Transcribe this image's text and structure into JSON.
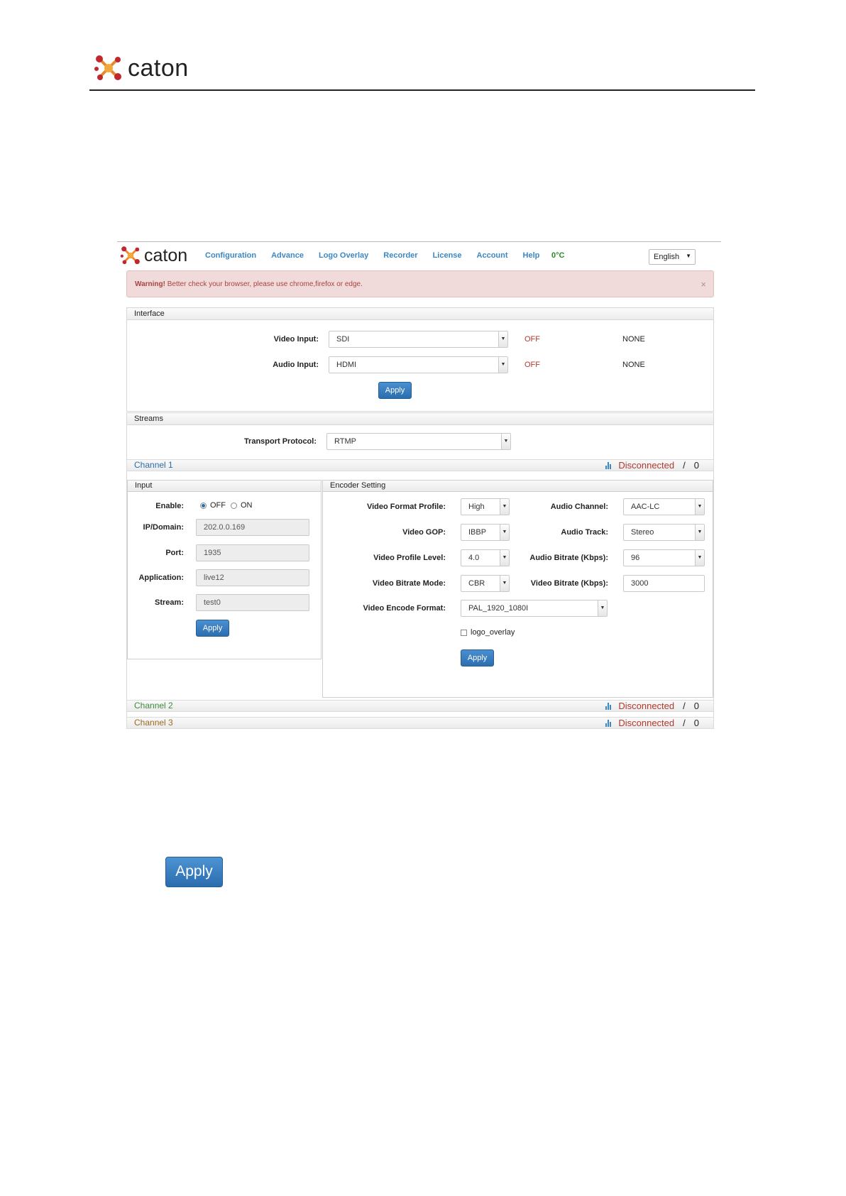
{
  "document": {
    "brand": "caton"
  },
  "nav": {
    "brand": "caton",
    "menu": [
      "Configuration",
      "Advance",
      "Logo Overlay",
      "Recorder",
      "License",
      "Account",
      "Help"
    ],
    "temperature": "0°C",
    "language": "English"
  },
  "warning": {
    "strong": "Warning!",
    "text": " Better check your browser, please use chrome,firefox or edge.",
    "close": "×"
  },
  "interface": {
    "title": "Interface",
    "video_input_label": "Video Input:",
    "video_input_value": "SDI",
    "video_status": "OFF",
    "video_signal": "NONE",
    "audio_input_label": "Audio Input:",
    "audio_input_value": "HDMI",
    "audio_status": "OFF",
    "audio_signal": "NONE",
    "apply": "Apply"
  },
  "streams": {
    "title": "Streams",
    "protocol_label": "Transport Protocol:",
    "protocol_value": "RTMP"
  },
  "channels": [
    {
      "name": "Channel 1",
      "color": "#2a6ea6",
      "status": "Disconnected",
      "sep": "/",
      "count": "0"
    },
    {
      "name": "Channel 2",
      "color": "#3f8a3f",
      "status": "Disconnected",
      "sep": "/",
      "count": "0"
    },
    {
      "name": "Channel 3",
      "color": "#9a6a1e",
      "status": "Disconnected",
      "sep": "/",
      "count": "0"
    }
  ],
  "input": {
    "title": "Input",
    "enable_label": "Enable:",
    "off": "OFF",
    "on": "ON",
    "ip_label": "IP/Domain:",
    "ip_value": "202.0.0.169",
    "port_label": "Port:",
    "port_value": "1935",
    "app_label": "Application:",
    "app_value": "live12",
    "stream_label": "Stream:",
    "stream_value": "test0",
    "apply": "Apply"
  },
  "encoder": {
    "title": "Encoder Setting",
    "format_profile_label": "Video Format Profile:",
    "format_profile_value": "High",
    "gop_label": "Video GOP:",
    "gop_value": "IBBP",
    "profile_level_label": "Video Profile Level:",
    "profile_level_value": "4.0",
    "bitrate_mode_label": "Video Bitrate Mode:",
    "bitrate_mode_value": "CBR",
    "encode_format_label": "Video Encode Format:",
    "encode_format_value": "PAL_1920_1080I",
    "audio_channel_label": "Audio Channel:",
    "audio_channel_value": "AAC-LC",
    "audio_track_label": "Audio Track:",
    "audio_track_value": "Stereo",
    "audio_bitrate_label": "Audio Bitrate (Kbps):",
    "audio_bitrate_value": "96",
    "video_bitrate_label": "Video Bitrate (Kbps):",
    "video_bitrate_value": "3000",
    "logo_overlay": "logo_overlay",
    "apply": "Apply"
  },
  "standalone_apply": "Apply"
}
